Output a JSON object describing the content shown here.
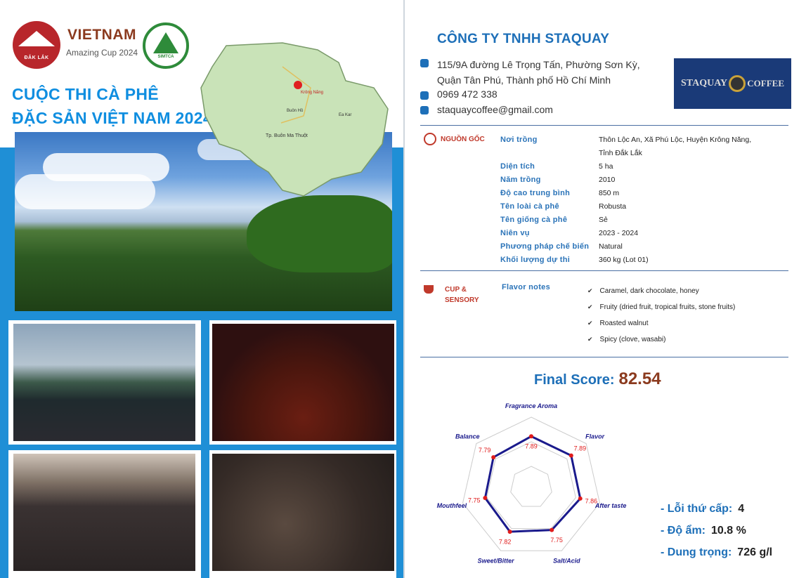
{
  "left": {
    "logo1_text": "ĐẮK LẮK",
    "brand_title": "VIETNAM",
    "brand_sub": "Amazing Cup 2024",
    "logo2_text": "SIMTCA",
    "logo2_ring": "HIỆP HỘI CÀ PHÊ BUÔN MA THUỘT",
    "heading_line1": "CUỘC THI CÀ PHÊ",
    "heading_line2": "ĐẶC SẢN VIỆT NAM 2024",
    "map_labels": [
      "Tp. Buôn Ma Thuột",
      "Krông Năng",
      "Ea Kar",
      "Buôn Hồ"
    ]
  },
  "company": {
    "name": "CÔNG TY TNHH STAQUAY",
    "address_line1": "115/9A đường Lê Trọng Tấn, Phường Sơn Kỳ,",
    "address_line2": "Quận Tân Phú, Thành phố Hồ Chí Minh",
    "phone": "0969 472 338",
    "email": "staquaycoffee@gmail.com",
    "logo_left": "STAQUAY",
    "logo_right": "COFFEE"
  },
  "origin": {
    "section_label": "NGUỒN GỐC",
    "rows": [
      {
        "label": "Nơi trồng",
        "value": "Thôn Lộc An, Xã Phú Lộc, Huyện Krông Năng,"
      },
      {
        "label": "",
        "value": "Tỉnh Đắk Lắk"
      },
      {
        "label": "Diện tích",
        "value": "5 ha"
      },
      {
        "label": "Năm trồng",
        "value": "2010"
      },
      {
        "label": "Độ cao trung bình",
        "value": "850 m"
      },
      {
        "label": "Tên loài cà phê",
        "value": "Robusta"
      },
      {
        "label": "Tên giống cà phê",
        "value": "Sẻ"
      },
      {
        "label": "Niên vụ",
        "value": "2023 - 2024"
      },
      {
        "label": "Phương pháp chế biến",
        "value": "Natural"
      },
      {
        "label": "Khối lượng dự thi",
        "value": "360 kg (Lot 01)"
      }
    ]
  },
  "sensory": {
    "section_label_1": "CUP &",
    "section_label_2": "SENSORY",
    "flavor_label": "Flavor notes",
    "notes": [
      "Caramel, dark chocolate, honey",
      "Fruity (dried fruit, tropical fruits, stone fruits)",
      "Roasted walnut",
      "Spicy (clove, wasabi)"
    ]
  },
  "score": {
    "label": "Final Score:",
    "value": "82.54"
  },
  "chart_data": {
    "type": "radar",
    "categories": [
      "Fragrance Aroma",
      "Flavor",
      "After taste",
      "Salt/Acid",
      "Sweet/Bitter",
      "Mouthfeel",
      "Balance"
    ],
    "values": [
      7.89,
      7.89,
      7.86,
      7.75,
      7.82,
      7.75,
      7.79
    ],
    "value_labels": [
      "7.89",
      "7.89",
      "7.86",
      "7.75",
      "7.82",
      "7.75",
      "7.79"
    ],
    "series_color": "#1a1a8c",
    "point_color": "#e01b1b"
  },
  "stats": [
    {
      "label": "- Lỗi thứ cấp:",
      "value": "4"
    },
    {
      "label": "- Độ ẩm:",
      "value": "10.8 %"
    },
    {
      "label": "- Dung trọng:",
      "value": "726 g/l"
    }
  ],
  "colors": {
    "blue": "#1f8fd6",
    "heading": "#0f8ee0",
    "brown": "#8b3a1e",
    "company": "#1d6fb8"
  }
}
